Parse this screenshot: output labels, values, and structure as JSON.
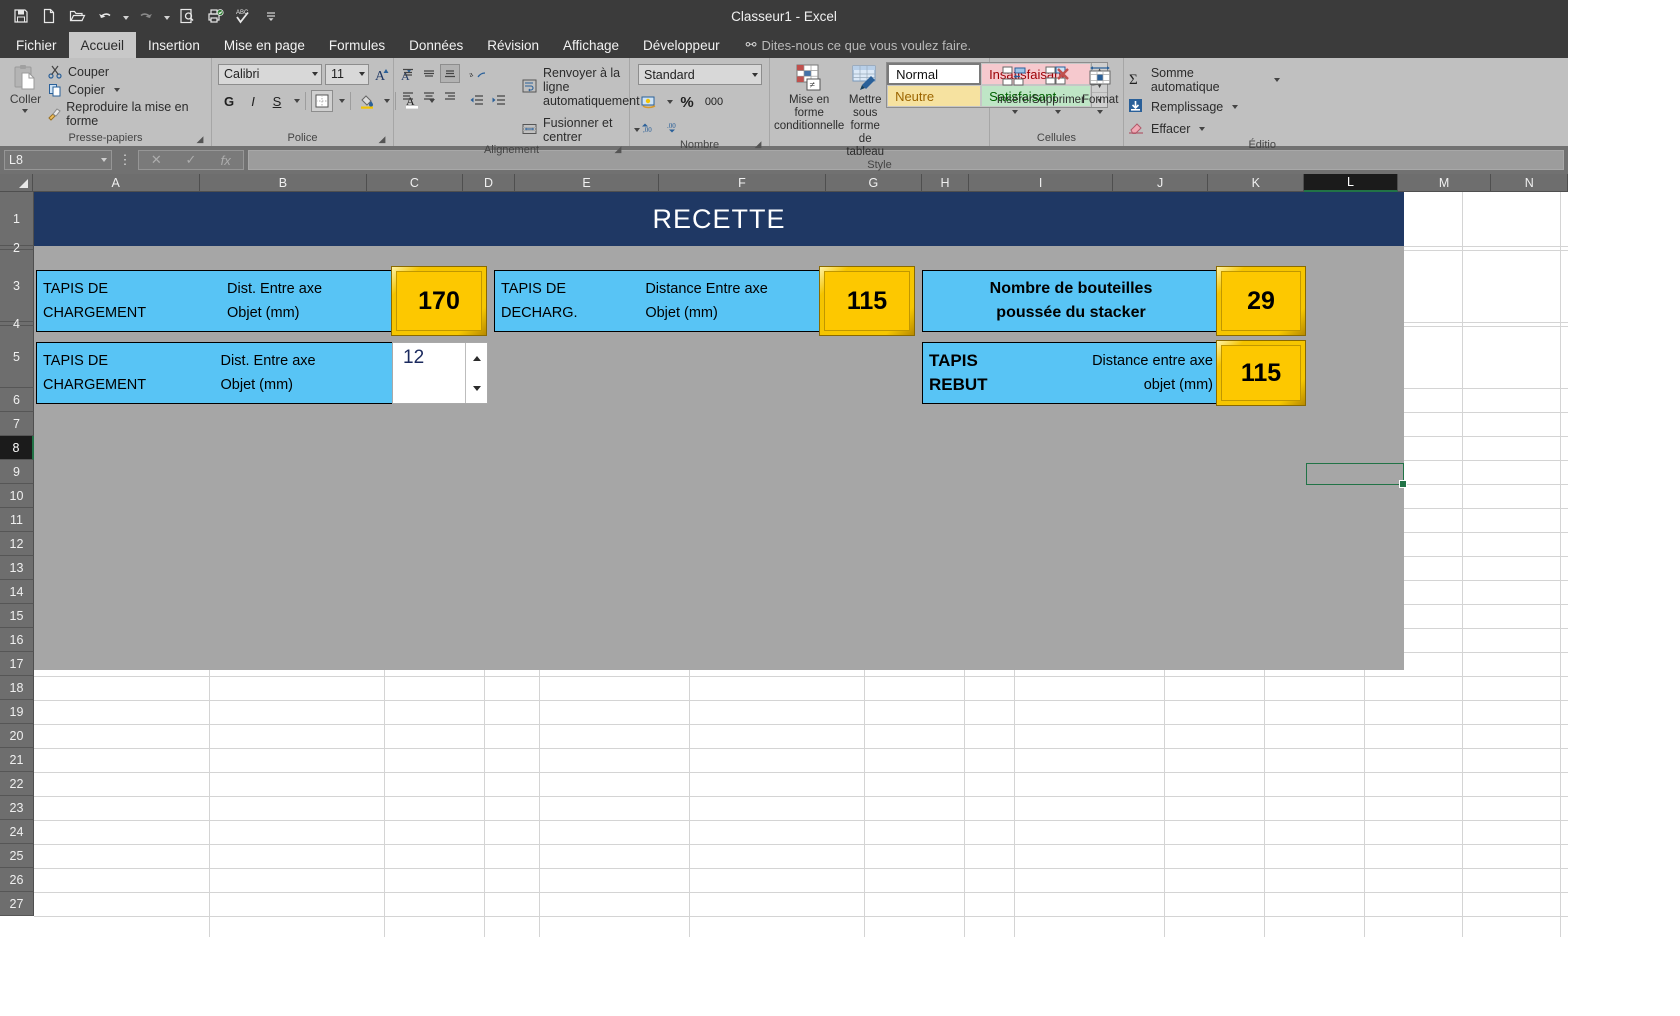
{
  "window": {
    "title": "Classeur1 - Excel"
  },
  "quick_access": [
    {
      "name": "save-icon",
      "label": "Enregistrer"
    },
    {
      "name": "new-document-icon",
      "label": "Nouveau"
    },
    {
      "name": "open-folder-icon",
      "label": "Ouvrir"
    },
    {
      "name": "undo-icon",
      "label": "Annuler"
    },
    {
      "name": "redo-icon",
      "label": "Rétablir"
    },
    {
      "name": "print-preview-icon",
      "label": "Aperçu avant impression"
    },
    {
      "name": "quick-print-icon",
      "label": "Impression rapide"
    },
    {
      "name": "spelling-icon",
      "label": "Orthographe"
    },
    {
      "name": "customize-qat-icon",
      "label": "Personnaliser"
    }
  ],
  "tabs": [
    {
      "label": "Fichier",
      "active": false
    },
    {
      "label": "Accueil",
      "active": true
    },
    {
      "label": "Insertion",
      "active": false
    },
    {
      "label": "Mise en page",
      "active": false
    },
    {
      "label": "Formules",
      "active": false
    },
    {
      "label": "Données",
      "active": false
    },
    {
      "label": "Révision",
      "active": false
    },
    {
      "label": "Affichage",
      "active": false
    },
    {
      "label": "Développeur",
      "active": false
    }
  ],
  "tell_me": "Dites-nous ce que vous voulez faire.",
  "ribbon": {
    "clipboard": {
      "group_label": "Presse-papiers",
      "paste_label": "Coller",
      "cut_label": "Couper",
      "copy_label": "Copier",
      "format_painter_label": "Reproduire la mise en forme"
    },
    "font": {
      "group_label": "Police",
      "font_name": "Calibri",
      "font_size": "11",
      "bold_label": "G",
      "italic_label": "I",
      "underline_label": "S"
    },
    "alignment": {
      "group_label": "Alignement",
      "wrap_text_label": "Renvoyer à la ligne automatiquement",
      "merge_label": "Fusionner et centrer"
    },
    "number": {
      "group_label": "Nombre",
      "format": "Standard",
      "percent_label": "%",
      "thousands_label": "000"
    },
    "styles": {
      "group_label": "Style",
      "conditional_label": "Mise en forme\nconditionnelle",
      "table_label": "Mettre sous forme\nde tableau",
      "cells": [
        {
          "label": "Normal",
          "kind": "normal"
        },
        {
          "label": "Insatisfaisant",
          "kind": "insat"
        },
        {
          "label": "Neutre",
          "kind": "neutre"
        },
        {
          "label": "Satisfaisant",
          "kind": "satis"
        }
      ]
    },
    "cells": {
      "group_label": "Cellules",
      "insert_label": "Insérer",
      "delete_label": "Supprimer",
      "format_label": "Format"
    },
    "editing": {
      "group_label": "Éditio",
      "autosum_label": "Somme automatique",
      "fill_label": "Remplissage",
      "clear_label": "Effacer"
    }
  },
  "formula_bar": {
    "name_box": "L8",
    "formula": ""
  },
  "grid": {
    "columns": [
      "A",
      "B",
      "C",
      "D",
      "E",
      "F",
      "G",
      "H",
      "I",
      "J",
      "K",
      "L",
      "M",
      "N"
    ],
    "selected_column": "L",
    "rows": [
      "1",
      "2",
      "3",
      "4",
      "5",
      "6",
      "7",
      "8",
      "9",
      "10",
      "11",
      "12",
      "13",
      "14",
      "15",
      "16",
      "17",
      "18",
      "19",
      "20",
      "21",
      "22",
      "23",
      "24",
      "25",
      "26",
      "27"
    ],
    "selected_row": "8",
    "selected_cell": "L8"
  },
  "sheet_content": {
    "banner_title": "RECETTE",
    "panels": [
      {
        "id": "tapis-chargement-1",
        "left_text": "TAPIS DE\nCHARGEMENT",
        "right_text": "Dist. Entre axe\nObjet (mm)",
        "value": "170",
        "value_style": "gold"
      },
      {
        "id": "tapis-decharg",
        "left_text": "TAPIS DE\nDECHARG.",
        "right_text": "Distance Entre axe\nObjet (mm)",
        "value": "115",
        "value_style": "gold"
      },
      {
        "id": "nombre-bouteilles",
        "center_text": "Nombre de bouteilles\npoussée du stacker",
        "value": "29",
        "value_style": "gold"
      },
      {
        "id": "tapis-chargement-2",
        "left_text": "TAPIS DE\nCHARGEMENT",
        "right_text": "Dist. Entre axe\nObjet (mm)",
        "value": "12",
        "value_style": "spinner"
      },
      {
        "id": "tapis-rebut",
        "left_text": "TAPIS\nREBUT",
        "right_text": "Distance entre axe\nobjet (mm)",
        "value": "115",
        "value_style": "gold"
      }
    ]
  },
  "colors": {
    "banner_blue": "#1f3864",
    "panel_blue": "#58c4f5",
    "gold": "#fdc800",
    "sheet_grey": "#a6a6a6",
    "excel_green": "#217346"
  }
}
